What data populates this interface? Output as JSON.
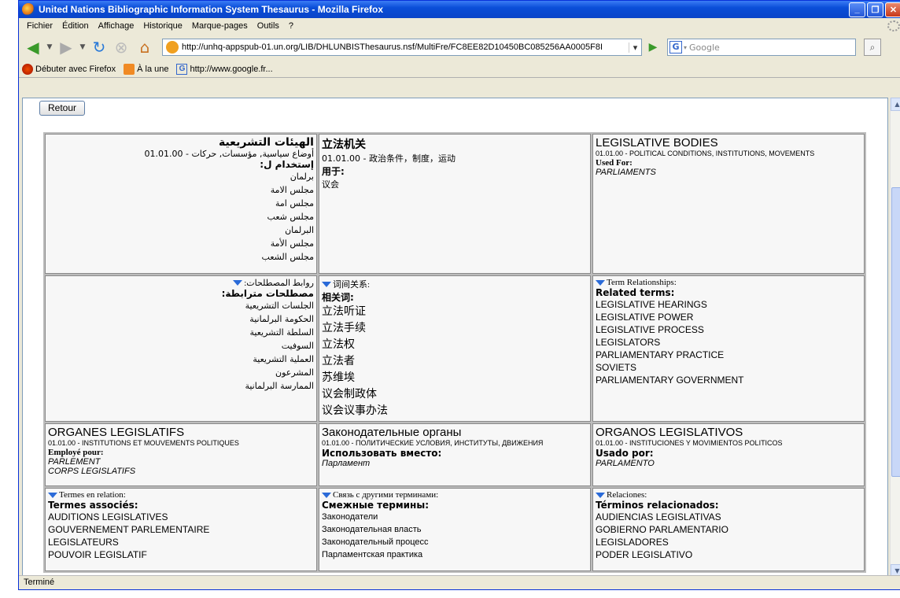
{
  "window": {
    "title": "United Nations Bibliographic Information System Thesaurus - Mozilla Firefox",
    "controls": {
      "minimize": "_",
      "maximize": "❐",
      "close": "✕"
    }
  },
  "menu": [
    "Fichier",
    "Édition",
    "Affichage",
    "Historique",
    "Marque-pages",
    "Outils",
    "?"
  ],
  "toolbar": {
    "url": "http://unhq-appspub-01.un.org/LIB/DHLUNBISThesaurus.nsf/MultiFre/FC8EE82D10450BC085256AA0005F8I",
    "search_placeholder": "Google",
    "search_engine_glyph": "G"
  },
  "bookmarks": [
    {
      "label": "Débuter avec Firefox",
      "icon": "firefox-icon"
    },
    {
      "label": "À la une",
      "icon": "rss-icon"
    },
    {
      "label": "http://www.google.fr...",
      "icon": "google-icon"
    }
  ],
  "status": "Terminé",
  "page": {
    "retour": "Retour",
    "ar": {
      "title": "الهيئات التشريعية",
      "category": "أوضاع سياسية, مؤسسات, حركات - 01.01.00",
      "used_for_label": "إستخدام ل:",
      "used_for": [
        "برلمان",
        "مجلس الامة",
        "مجلس امة",
        "مجلس شعب",
        "البرلمان",
        "مجلس الأمة",
        "مجلس الشعب"
      ],
      "rel_head": "روابط المصطلحات:",
      "related_label": "مصطلحات مترابطة:",
      "related": [
        "الجلسات التشريعية",
        "الحكومة البرلمانية",
        "السلطة التشريعية",
        "السوفيت",
        "العملية التشريعية",
        "المشرعون",
        "الممارسة البرلمانية"
      ]
    },
    "zh": {
      "title": "立法机关",
      "category": "01.01.00 - 政治条件，制度，运动",
      "used_for_label": "用于:",
      "used_for": [
        "议会"
      ],
      "rel_head": "词间关系:",
      "related_label": "相关词:",
      "related": [
        "立法听证",
        "立法手续",
        "立法权",
        "立法者",
        "苏维埃",
        "议会制政体",
        "议会议事办法"
      ]
    },
    "en": {
      "title": "LEGISLATIVE BODIES",
      "category": "01.01.00 - POLITICAL CONDITIONS, INSTITUTIONS, MOVEMENTS",
      "used_for_label": "Used For:",
      "used_for": [
        "PARLIAMENTS"
      ],
      "rel_head": "Term Relationships:",
      "related_label": "Related terms:",
      "related": [
        "LEGISLATIVE HEARINGS",
        "LEGISLATIVE POWER",
        "LEGISLATIVE PROCESS",
        "LEGISLATORS",
        "PARLIAMENTARY PRACTICE",
        "SOVIETS",
        "PARLIAMENTARY GOVERNMENT"
      ]
    },
    "fr": {
      "title": "ORGANES LEGISLATIFS",
      "category": "01.01.00 - INSTITUTIONS ET MOUVEMENTS POLITIQUES",
      "used_for_label": "Employé pour:",
      "used_for": [
        "PARLEMENT",
        "CORPS LEGISLATIFS"
      ],
      "rel_head": "Termes en relation:",
      "related_label": "Termes associés:",
      "related": [
        "AUDITIONS LEGISLATIVES",
        "GOUVERNEMENT PARLEMENTAIRE",
        "LEGISLATEURS",
        "POUVOIR LEGISLATIF"
      ]
    },
    "ru": {
      "title": "Законодательные органы",
      "category": "01.01.00 - ПОЛИТИЧЕСКИЕ УСЛОВИЯ, ИНСТИТУТЫ, ДВИЖЕНИЯ",
      "used_for_label": "Использовать вместо:",
      "used_for": [
        "Парламент"
      ],
      "rel_head": "Связь с другими терминами:",
      "related_label": "Смежные термины:",
      "related": [
        "Законодатели",
        "Законодательная власть",
        "Законодательный процесс",
        "Парламентская практика"
      ]
    },
    "es": {
      "title": "ORGANOS LEGISLATIVOS",
      "category": "01.01.00 - INSTITUCIONES Y MOVIMIENTOS POLITICOS",
      "used_for_label": "Usado por:",
      "used_for": [
        "PARLAMENTO"
      ],
      "rel_head": "Relaciones:",
      "related_label": "Términos relacionados:",
      "related": [
        "AUDIENCIAS LEGISLATIVAS",
        "GOBIERNO PARLAMENTARIO",
        "LEGISLADORES",
        "PODER LEGISLATIVO"
      ]
    }
  }
}
